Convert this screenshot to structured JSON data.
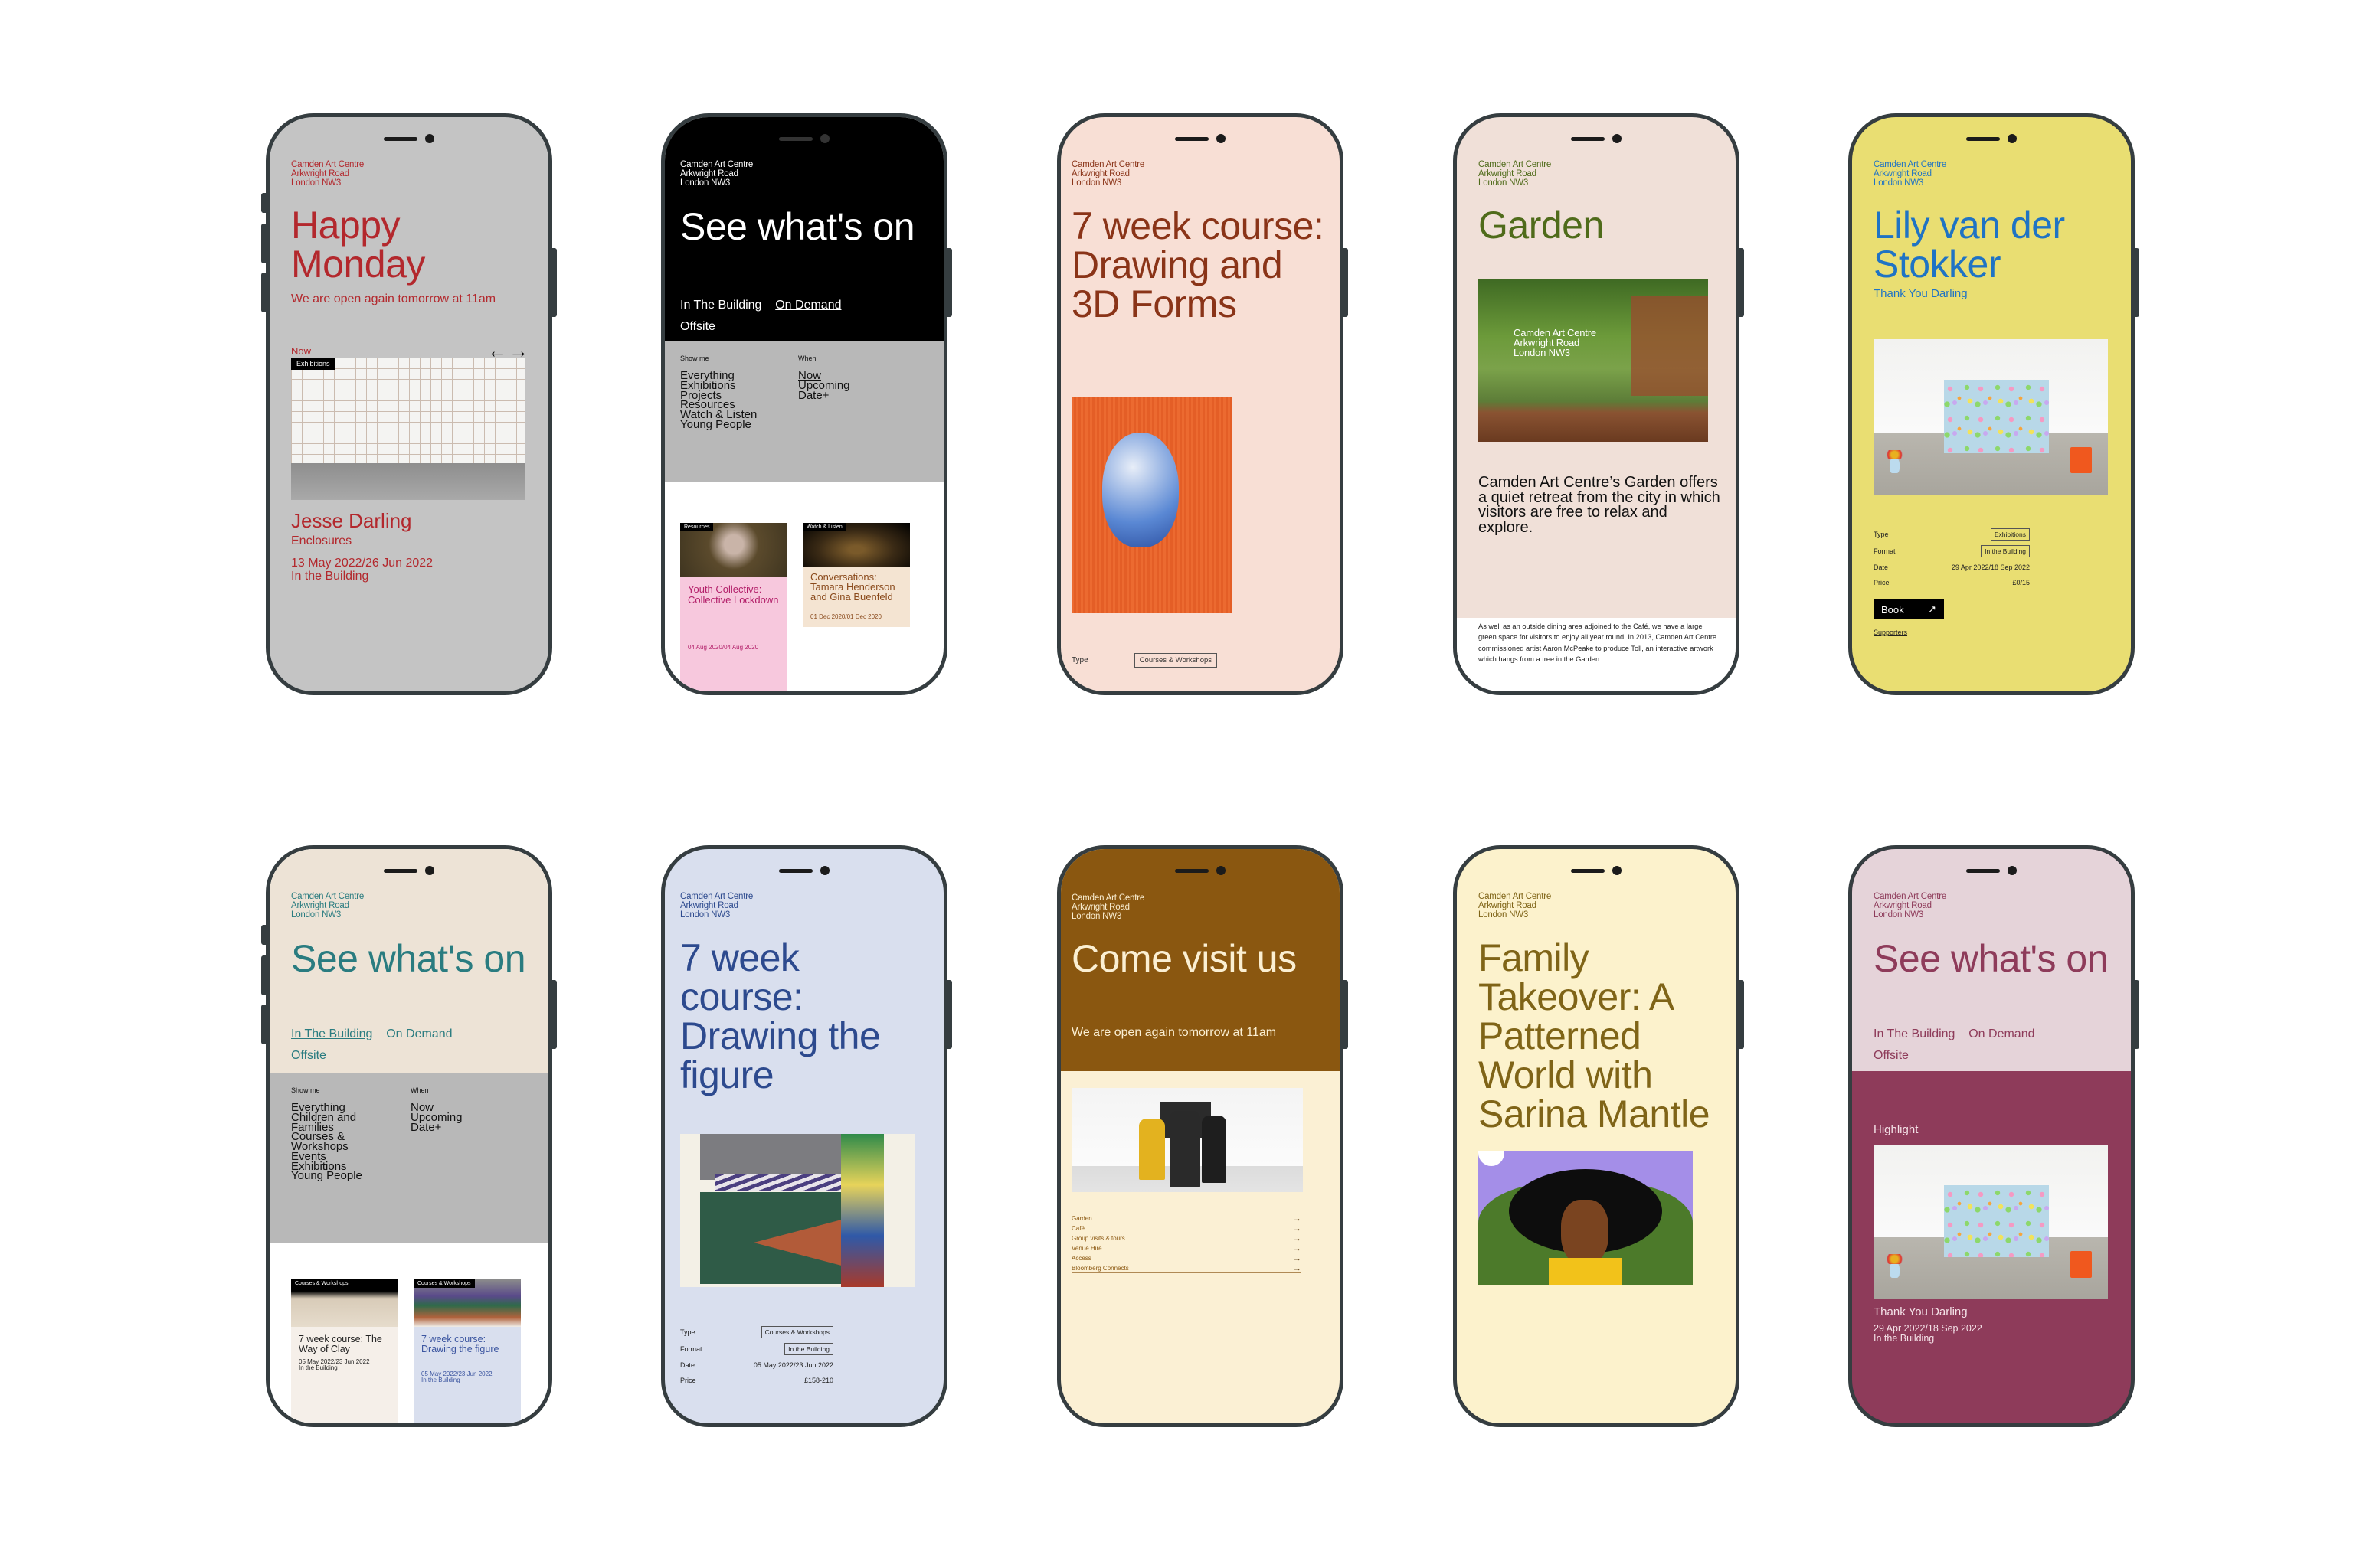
{
  "common": {
    "address": [
      "Camden Art Centre",
      "Arkwright Road",
      "London NW3"
    ]
  },
  "phones": [
    {
      "id": "happy-monday",
      "colors": {
        "bg": "#c4c4c4",
        "fg": "#b3282d"
      },
      "title": "Happy Monday",
      "subtitle": "We are open again tomorrow at 11am",
      "section_label": "Now",
      "nav_prev": "←",
      "nav_next": "→",
      "card": {
        "tag": "Exhibitions",
        "artist": "Jesse Darling",
        "exhibition": "Enclosures",
        "dates": "13 May 2022/26 Jun 2022",
        "location": "In the Building"
      }
    },
    {
      "id": "see-whats-on-black",
      "colors": {
        "bg": "#000000",
        "fg": "#ffffff",
        "filter_bg": "#b8b8b8"
      },
      "title": "See what's on",
      "tabs": [
        {
          "label": "In The Building",
          "active": false
        },
        {
          "label": "On Demand",
          "active": true
        },
        {
          "label": "Offsite",
          "active": false
        }
      ],
      "show_me_label": "Show me",
      "show_me": [
        "Everything",
        "Exhibitions",
        "Projects",
        "Resources",
        "Watch & Listen",
        "Young People"
      ],
      "when_label": "When",
      "when": [
        {
          "label": "Now",
          "active": true
        },
        {
          "label": "Upcoming",
          "active": false
        },
        {
          "label": "Date+",
          "active": false
        }
      ],
      "cards": [
        {
          "tag": "Resources",
          "title": "Youth Collective: Collective Lockdown",
          "dates": "04 Aug 2020/04 Aug 2020",
          "bg": "#f7c8dd",
          "fg": "#b3206a"
        },
        {
          "tag": "Watch & Listen",
          "title": "Conversations: Tamara Henderson and Gina Buenfeld",
          "dates": "01 Dec 2020/01 Dec 2020",
          "bg": "#f4e4d2",
          "fg": "#8a4a1c"
        }
      ]
    },
    {
      "id": "drawing-3d-forms",
      "colors": {
        "bg": "#f8dfd5",
        "fg": "#8a3418"
      },
      "title": "7 week course: Drawing and 3D Forms",
      "meta": [
        {
          "label": "Type",
          "value": "Courses & Workshops",
          "chip": true
        }
      ]
    },
    {
      "id": "garden",
      "colors": {
        "bg": "#f0e0d8",
        "fg": "#4f6b1a"
      },
      "title": "Garden",
      "image_overlay": [
        "Camden Art Centre",
        "Arkwright Road",
        "London NW3"
      ],
      "lead": "Camden Art Centre’s Garden offers a quiet retreat from the city in which visitors are free to relax and explore.",
      "body": "As well as an outside dining area adjoined to the Café, we have a large green space for visitors to enjoy all year round.  In 2013, Camden Art Centre commissioned artist  Aaron McPeake to produce Toll, an interactive artwork which hangs from a tree in the Garden"
    },
    {
      "id": "lily-van-der-stokker",
      "colors": {
        "bg": "#e9de72",
        "fg": "#1f73c4"
      },
      "title": "Lily van der Stokker",
      "subtitle": "Thank You Darling",
      "meta": [
        {
          "label": "Type",
          "value": "Exhibitions",
          "chip": true
        },
        {
          "label": "Format",
          "value": "In the Building",
          "chip": true
        },
        {
          "label": "Date",
          "value": "29 Apr 2022/18 Sep 2022",
          "chip": false
        },
        {
          "label": "Price",
          "value": "£0/15",
          "chip": false
        }
      ],
      "book_label": "Book",
      "book_icon": "↗",
      "supporters_label": "Supporters"
    },
    {
      "id": "see-whats-on-teal",
      "colors": {
        "bg": "#ede3d6",
        "fg": "#2a7c80",
        "filter_bg": "#b8b8b8"
      },
      "title": "See what's on",
      "tabs": [
        {
          "label": "In The Building",
          "active": true
        },
        {
          "label": "On Demand",
          "active": false
        },
        {
          "label": "Offsite",
          "active": false
        }
      ],
      "show_me_label": "Show me",
      "show_me": [
        "Everything",
        "Children and Families",
        "Courses & Workshops",
        "Events",
        "Exhibitions",
        "Young People"
      ],
      "when_label": "When",
      "when": [
        {
          "label": "Now",
          "active": true
        },
        {
          "label": "Upcoming",
          "active": false
        },
        {
          "label": "Date+",
          "active": false
        }
      ],
      "cards": [
        {
          "tag": "Courses & Workshops",
          "title": "7 week course: The Way of Clay",
          "dates": "05 May 2022/23 Jun 2022",
          "location": "In the Building",
          "bg": "#f5efe9",
          "fg": "#222222"
        },
        {
          "tag": "Courses & Workshops",
          "title": "7 week course: Drawing the figure",
          "dates": "05 May 2022/23 Jun 2022",
          "location": "In the Building",
          "bg": "#d9dfee",
          "fg": "#3b55a0"
        }
      ]
    },
    {
      "id": "drawing-the-figure",
      "colors": {
        "bg": "#d9dfee",
        "fg": "#2d4a8e"
      },
      "title": "7 week course: Drawing the figure",
      "meta": [
        {
          "label": "Type",
          "value": "Courses & Workshops",
          "chip": true
        },
        {
          "label": "Format",
          "value": "In the Building",
          "chip": true
        },
        {
          "label": "Date",
          "value": "05 May 2022/23 Jun 2022",
          "chip": false
        },
        {
          "label": "Price",
          "value": "£158-210",
          "chip": false
        }
      ]
    },
    {
      "id": "come-visit-us",
      "colors": {
        "bg": "#8a5710",
        "fg": "#fbefd2",
        "lower_bg": "#fbf0d4",
        "link_fg": "#8a5710"
      },
      "title": "Come visit us",
      "subtitle": "We are open again tomorrow at 11am",
      "links": [
        "Garden",
        "Café",
        "Group visits & tours",
        "Venue Hire",
        "Access",
        "Bloomberg Connects"
      ],
      "link_icon": "→"
    },
    {
      "id": "family-takeover",
      "colors": {
        "bg": "#fcf2cc",
        "fg": "#7f6417"
      },
      "title": "Family Takeover: A Patterned World with Sarina Mantle"
    },
    {
      "id": "see-whats-on-plum",
      "colors": {
        "bg": "#e5d3d9",
        "fg": "#8e3b5a",
        "lower_bg": "#8e3b5a",
        "lower_fg": "#f5e2e8"
      },
      "title": "See what's on",
      "tabs": [
        {
          "label": "In The Building",
          "active": false
        },
        {
          "label": "On Demand",
          "active": false
        },
        {
          "label": "Offsite",
          "active": false
        }
      ],
      "highlight_label": "Highlight",
      "card": {
        "title": "Thank You Darling",
        "dates": "29 Apr 2022/18 Sep 2022",
        "location": "In the Building"
      }
    }
  ]
}
